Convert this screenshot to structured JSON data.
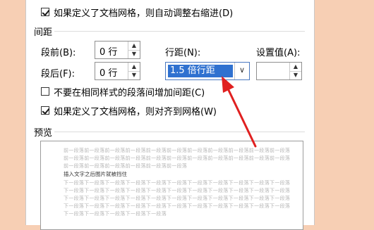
{
  "dialog": {
    "option_auto_indent": {
      "label": "如果定义了文档网格，则自动调整右缩进(D)",
      "checked": true
    },
    "section_spacing": "间距",
    "before": {
      "label": "段前(B):",
      "value": "0 行"
    },
    "after": {
      "label": "段后(F):",
      "value": "0 行"
    },
    "line_spacing": {
      "label": "行距(N):",
      "value": "1.5 倍行距"
    },
    "set_value": {
      "label": "设置值(A):",
      "value": ""
    },
    "option_no_space_same_style": {
      "label": "不要在相同样式的段落间增加间距(C)",
      "checked": false
    },
    "option_snap_grid": {
      "label": "如果定义了文档网格，则对齐到网格(W)",
      "checked": true
    },
    "section_preview": "预览",
    "preview": {
      "prev_lines": [
        "前一段落前一段落前一段落前一段落前一段落前一段落前一段落前一段落前一段落前一段落前一段落",
        "前一段落前一段落前一段落前一段落前一段落前一段落前一段落前一段落前一段落前一段落前一段落",
        "前一段落前一段落前一段落前一段落前一段落前一段落"
      ],
      "sample": "插入文字之后图片就被挡住",
      "next_lines": [
        "下一段落下一段落下一段落下一段落下一段落下一段落下一段落下一段落下一段落下一段落下一段落",
        "下一段落下一段落下一段落下一段落下一段落下一段落下一段落下一段落下一段落下一段落下一段落",
        "下一段落下一段落下一段落下一段落下一段落下一段落下一段落下一段落下一段落下一段落下一段落",
        "下一段落下一段落下一段落下一段落下一段落下一段落下一段落下一段落下一段落下一段落下一段落",
        "下一段落下一段落下一段落下一段落下一段落"
      ]
    }
  },
  "colors": {
    "background": "#f7cfb4",
    "selection": "#2f71d0",
    "arrow": "#e02020"
  }
}
